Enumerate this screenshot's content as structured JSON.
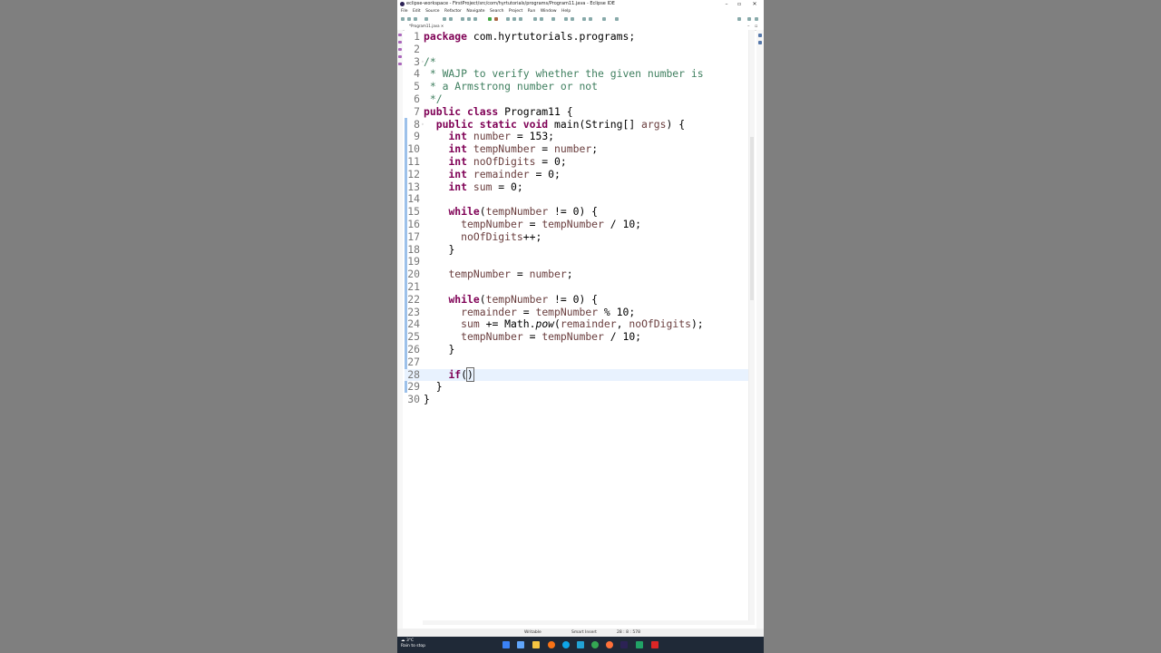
{
  "window": {
    "title": "eclipse-workspace - FirstProject/src/com/hyrtutorials/programs/Program11.java - Eclipse IDE"
  },
  "menu": [
    "File",
    "Edit",
    "Source",
    "Refactor",
    "Navigate",
    "Search",
    "Project",
    "Run",
    "Window",
    "Help"
  ],
  "editor_tab": {
    "label": "*Program11.java"
  },
  "code_lines": [
    {
      "n": "1"
    },
    {
      "n": "2"
    },
    {
      "n": "3"
    },
    {
      "n": "4"
    },
    {
      "n": "5"
    },
    {
      "n": "6"
    },
    {
      "n": "7"
    },
    {
      "n": "8"
    },
    {
      "n": "9"
    },
    {
      "n": "10"
    },
    {
      "n": "11"
    },
    {
      "n": "12"
    },
    {
      "n": "13"
    },
    {
      "n": "14"
    },
    {
      "n": "15"
    },
    {
      "n": "16"
    },
    {
      "n": "17"
    },
    {
      "n": "18"
    },
    {
      "n": "19"
    },
    {
      "n": "20"
    },
    {
      "n": "21"
    },
    {
      "n": "22"
    },
    {
      "n": "23"
    },
    {
      "n": "24"
    },
    {
      "n": "25"
    },
    {
      "n": "26"
    },
    {
      "n": "27"
    },
    {
      "n": "28"
    },
    {
      "n": "29"
    },
    {
      "n": "30"
    }
  ],
  "code": {
    "l1_kw": "package",
    "l1_rest": " com.hyrtutorials.programs;",
    "l3": "/*",
    "l4": " * WAJP to verify whether the given number is",
    "l5": " * a Armstrong number or not",
    "l6": " */",
    "l7_kw": "public class",
    "l7_rest": " Program11 {",
    "l8_kw1": "public static void",
    "l8_rest": " main(String[] ",
    "l8_id": "args",
    "l8_end": ") {",
    "kw_int": "int",
    "l9_id": "number",
    "l9_rest": " = 153;",
    "l10_id": "tempNumber",
    "l10_a": " = ",
    "l10_id2": "number",
    "l10_b": ";",
    "l11_id": "noOfDigits",
    "l11_rest": " = 0;",
    "l12_id": "remainder",
    "l12_rest": " = 0;",
    "l13_id": "sum",
    "l13_rest": " = 0;",
    "kw_while": "while",
    "l15_a": "(",
    "l15_id": "tempNumber",
    "l15_b": " != 0) {",
    "l16_id": "tempNumber",
    "l16_a": " = ",
    "l16_id2": "tempNumber",
    "l16_b": " / 10;",
    "l17_id": "noOfDigits",
    "l17_b": "++;",
    "close_brace": "}",
    "l20_id": "tempNumber",
    "l20_a": " = ",
    "l20_id2": "number",
    "l20_b": ";",
    "l22_a": "(",
    "l22_id": "tempNumber",
    "l22_b": " != 0) {",
    "l23_id": "remainder",
    "l23_a": " = ",
    "l23_id2": "tempNumber",
    "l23_b": " % 10;",
    "l24_id": "sum",
    "l24_a": " += Math.",
    "l24_fn": "pow",
    "l24_b": "(",
    "l24_id2": "remainder",
    "l24_c": ", ",
    "l24_id3": "noOfDigits",
    "l24_d": ");",
    "l25_id": "tempNumber",
    "l25_a": " = ",
    "l25_id2": "tempNumber",
    "l25_b": " / 10;",
    "kw_if": "if",
    "l28_open": "(",
    "l28_close": ")"
  },
  "status": {
    "mode": "Writable",
    "insert": "Smart Insert",
    "position": "28 : 8 : 578"
  },
  "taskbar": {
    "temp": "3°C",
    "weather": "Rain to stop"
  },
  "colors": {
    "keyword": "#7f0055",
    "comment": "#3f7f5f",
    "variable": "#6a3e3e",
    "current_line": "#e8f2fe"
  }
}
